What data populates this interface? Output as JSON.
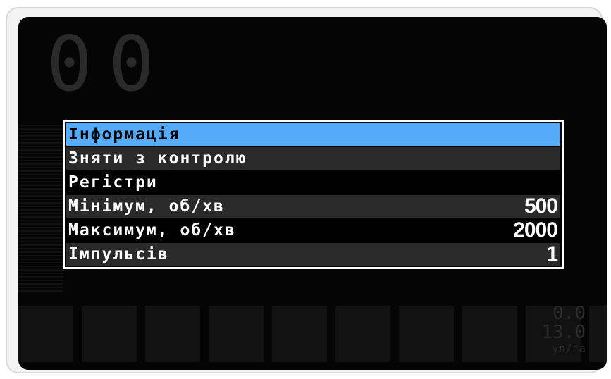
{
  "menu": {
    "items": [
      {
        "label": "Інформація",
        "value": ""
      },
      {
        "label": "Зняти з контролю",
        "value": ""
      },
      {
        "label": "Регістри",
        "value": ""
      },
      {
        "label": "Мінімум, об/хв",
        "value": "500"
      },
      {
        "label": "Максимум, об/хв",
        "value": "2000"
      },
      {
        "label": "Імпульсів",
        "value": "1"
      }
    ],
    "selected_index": 0,
    "selected_color": "#55abf7"
  },
  "background": {
    "speed_integer": "0",
    "speed_decimal": "0",
    "readout_1": "0.0",
    "readout_2": "13.0",
    "unit": "ул/га"
  }
}
